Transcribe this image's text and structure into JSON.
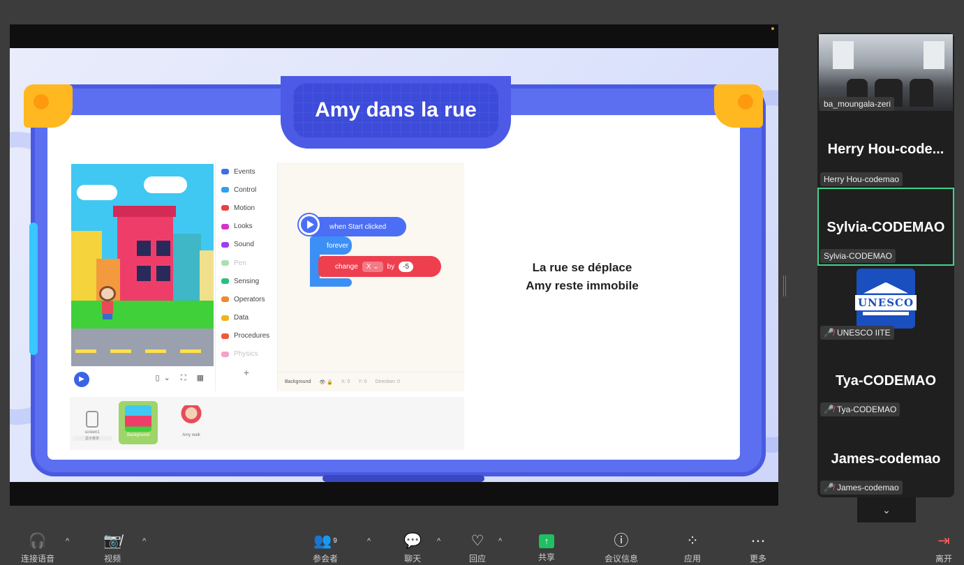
{
  "slide": {
    "title": "Amy dans la rue",
    "text_line1": "La rue se déplace",
    "text_line2": "Amy reste immobile"
  },
  "editor": {
    "categories": [
      {
        "label": "Events",
        "color": "#3c6cf0"
      },
      {
        "label": "Control",
        "color": "#2e9ff0"
      },
      {
        "label": "Motion",
        "color": "#e8433f"
      },
      {
        "label": "Looks",
        "color": "#d632c8"
      },
      {
        "label": "Sound",
        "color": "#a13cf0"
      },
      {
        "label": "Pen",
        "color": "#3fbf55"
      },
      {
        "label": "Sensing",
        "color": "#27c27a"
      },
      {
        "label": "Operators",
        "color": "#f08a2e"
      },
      {
        "label": "Data",
        "color": "#f0b21e"
      },
      {
        "label": "Procedures",
        "color": "#ef5a3a"
      },
      {
        "label": "Physics",
        "color": "#e83f8f"
      }
    ],
    "add_label": "+",
    "blocks": {
      "hat": "when Start clicked",
      "loop": "forever",
      "change_label": "change",
      "change_var": "X",
      "by_label": "by",
      "change_value": "-5"
    },
    "bottom_bar": {
      "sprite_label": "Background",
      "x_label": "X:",
      "x_value": "0",
      "y_label": "Y:",
      "y_value": "0",
      "dir_label": "Direction:",
      "dir_value": "0"
    },
    "sprites": [
      {
        "label": "screen1",
        "tag": "显示菜单"
      },
      {
        "label": "Background"
      },
      {
        "label": "Amy walk"
      }
    ]
  },
  "participants": [
    {
      "name": "ba_moungala-zeri"
    },
    {
      "display": "Herry  Hou-code...",
      "name": "Herry Hou-codemao"
    },
    {
      "display": "Sylvia-CODEMAO",
      "name": "Sylvia-CODEMAO"
    },
    {
      "name": "UNESCO IITE",
      "logo_text": "UNESCO"
    },
    {
      "display": "Tya-CODEMAO",
      "name": "Tya-CODEMAO"
    },
    {
      "display": "James-codemao",
      "name": "James-codemao"
    }
  ],
  "collapse_icon": "chevron-down-icon",
  "toolbar": {
    "audio": "连接语音",
    "video": "视频",
    "participants": "参会者",
    "participants_count": "9",
    "chat": "聊天",
    "react": "回应",
    "share": "共享",
    "meeting_info": "会议信息",
    "apps": "应用",
    "more": "更多",
    "leave": "离开"
  },
  "colors": {
    "active_speaker": "#3ed58a",
    "share_green": "#1fbf62",
    "slide_frame": "#5b6ff0",
    "muted_red": "#ff4d4d"
  }
}
